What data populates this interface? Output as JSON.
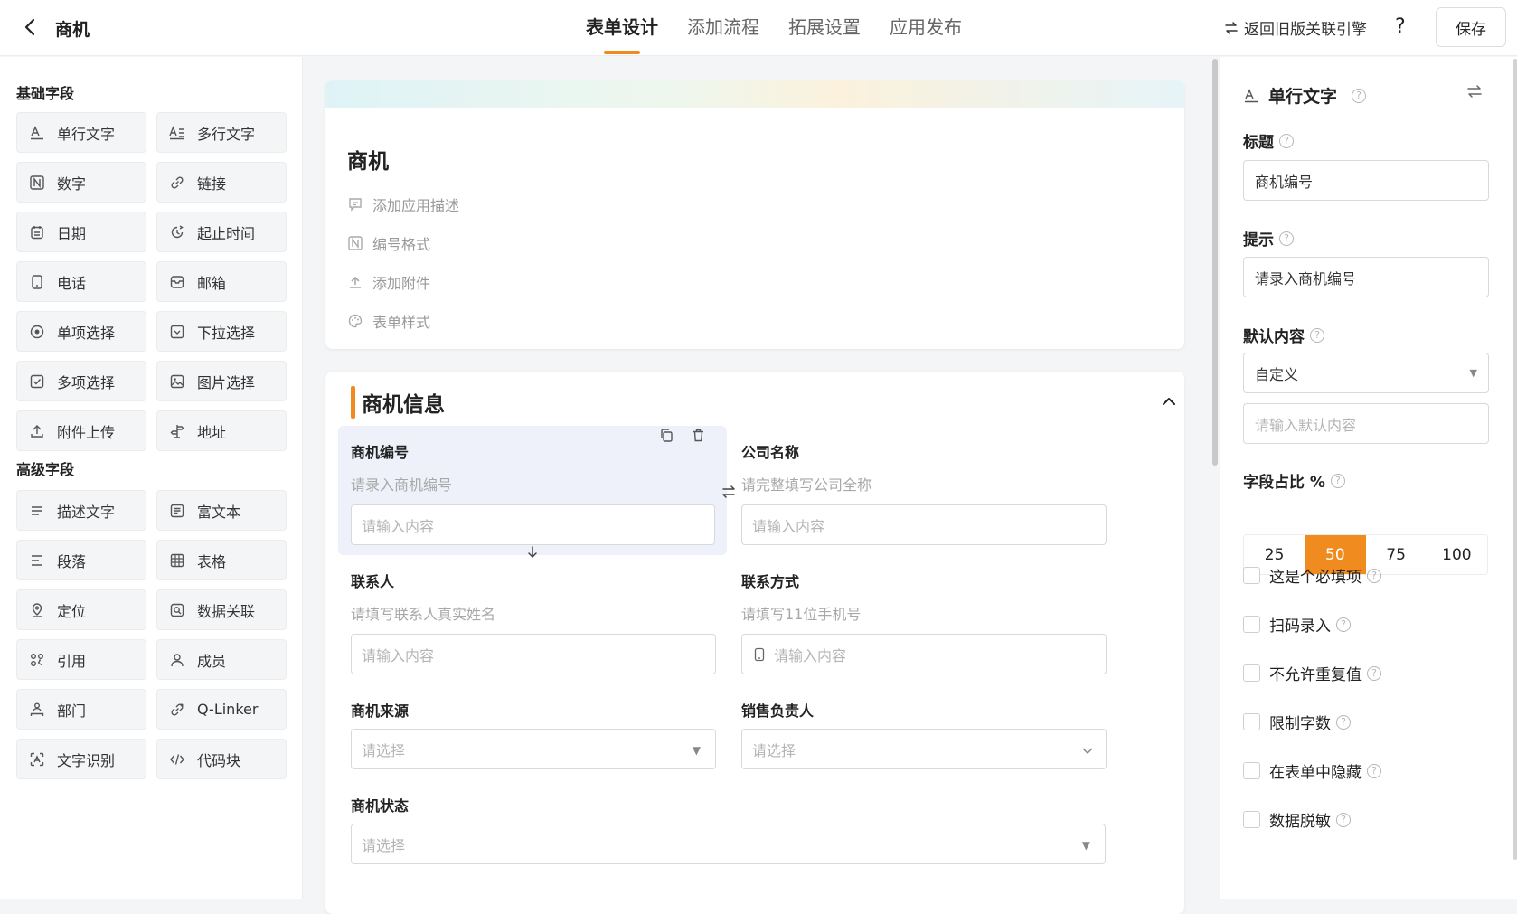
{
  "header": {
    "app_title": "商机",
    "tabs": [
      "表单设计",
      "添加流程",
      "拓展设置",
      "应用发布"
    ],
    "active_tab": 0,
    "legacy_link": "返回旧版关联引擎",
    "help": "?",
    "save_label": "保存"
  },
  "palette": {
    "basic_title": "基础字段",
    "basic_fields": [
      {
        "label": "单行文字",
        "icon": "single-line-text-icon"
      },
      {
        "label": "多行文字",
        "icon": "multi-line-text-icon"
      },
      {
        "label": "数字",
        "icon": "number-icon"
      },
      {
        "label": "链接",
        "icon": "link-icon"
      },
      {
        "label": "日期",
        "icon": "calendar-icon"
      },
      {
        "label": "起止时间",
        "icon": "clock-range-icon"
      },
      {
        "label": "电话",
        "icon": "phone-icon"
      },
      {
        "label": "邮箱",
        "icon": "mail-icon"
      },
      {
        "label": "单项选择",
        "icon": "radio-icon"
      },
      {
        "label": "下拉选择",
        "icon": "dropdown-icon"
      },
      {
        "label": "多项选择",
        "icon": "checkbox-icon"
      },
      {
        "label": "图片选择",
        "icon": "image-icon"
      },
      {
        "label": "附件上传",
        "icon": "upload-icon"
      },
      {
        "label": "地址",
        "icon": "signpost-icon"
      }
    ],
    "advanced_title": "高级字段",
    "advanced_fields": [
      {
        "label": "描述文字",
        "icon": "description-icon"
      },
      {
        "label": "富文本",
        "icon": "rich-text-icon"
      },
      {
        "label": "段落",
        "icon": "paragraph-icon"
      },
      {
        "label": "表格",
        "icon": "table-icon"
      },
      {
        "label": "定位",
        "icon": "location-icon"
      },
      {
        "label": "数据关联",
        "icon": "data-link-icon"
      },
      {
        "label": "引用",
        "icon": "reference-icon"
      },
      {
        "label": "成员",
        "icon": "member-icon"
      },
      {
        "label": "部门",
        "icon": "department-icon"
      },
      {
        "label": "Q-Linker",
        "icon": "q-linker-icon"
      },
      {
        "label": "文字识别",
        "icon": "ocr-icon"
      },
      {
        "label": "代码块",
        "icon": "code-icon"
      }
    ]
  },
  "form": {
    "title": "商机",
    "meta": [
      "添加应用描述",
      "编号格式",
      "添加附件",
      "表单样式"
    ],
    "section_title": "商机信息",
    "fields": {
      "opp_no": {
        "label": "商机编号",
        "hint": "请录入商机编号",
        "placeholder": "请输入内容"
      },
      "company": {
        "label": "公司名称",
        "hint": "请完整填写公司全称",
        "placeholder": "请输入内容"
      },
      "contact": {
        "label": "联系人",
        "hint": "请填写联系人真实姓名",
        "placeholder": "请输入内容"
      },
      "phone": {
        "label": "联系方式",
        "hint": "请填写11位手机号",
        "placeholder": "请输入内容"
      },
      "source": {
        "label": "商机来源",
        "placeholder": "请选择"
      },
      "owner": {
        "label": "销售负责人",
        "placeholder": "请选择"
      },
      "status": {
        "label": "商机状态",
        "placeholder": "请选择"
      }
    }
  },
  "props": {
    "field_type": "单行文字",
    "title_label": "标题",
    "title_value": "商机编号",
    "hint_label": "提示",
    "hint_value": "请录入商机编号",
    "default_label": "默认内容",
    "default_mode": "自定义",
    "default_placeholder": "请输入默认内容",
    "width_label": "字段占比 %",
    "width_options": [
      "25",
      "50",
      "75",
      "100"
    ],
    "width_selected": "50",
    "checks": [
      "这是个必填项",
      "扫码录入",
      "不允许重复值",
      "限制字数",
      "在表单中隐藏",
      "数据脱敏"
    ]
  },
  "colors": {
    "accent": "#f08c1f",
    "selected_bg": "#eef1fa"
  }
}
